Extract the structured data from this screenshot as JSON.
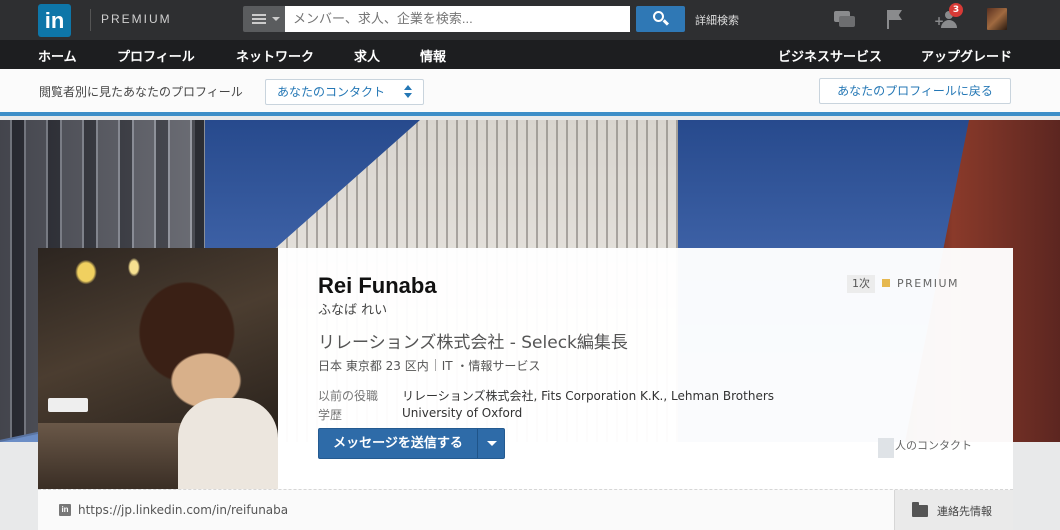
{
  "header": {
    "logo": "in",
    "premium_label": "PREMIUM",
    "search_placeholder": "メンバー、求人、企業を検索...",
    "advanced_search": "詳細検索",
    "notification_count": "3"
  },
  "nav": {
    "items": [
      "ホーム",
      "プロフィール",
      "ネットワーク",
      "求人",
      "情報"
    ],
    "business": "ビジネスサービス",
    "upgrade": "アップグレード"
  },
  "viewer_bar": {
    "label": "閲覧者別に見たあなたのプロフィール",
    "select_value": "あなたのコンタクト",
    "back_button": "あなたのプロフィールに戻る"
  },
  "profile": {
    "name": "Rei Funaba",
    "name_kana": "ふなば れい",
    "headline": "リレーションズ株式会社 - Seleck編集長",
    "location": "日本 東京都 23 区内",
    "industry": "IT ・情報サービス",
    "previous_label": "以前の役職",
    "previous_value": "リレーションズ株式会社, Fits Corporation K.K., Lehman Brothers",
    "education_label": "学歴",
    "education_value": "University of Oxford",
    "message_button": "メッセージを送信する",
    "degree": "1次",
    "premium_badge": "PREMIUM",
    "connections_label": "人のコンタクト",
    "public_url": "https://jp.linkedin.com/in/reifunaba",
    "contact_info": "連絡先情報"
  },
  "colors": {
    "brand": "#0e76a8",
    "accent_blue": "#2477b5",
    "premium_gold": "#e6b850",
    "badge_red": "#d73a36"
  }
}
